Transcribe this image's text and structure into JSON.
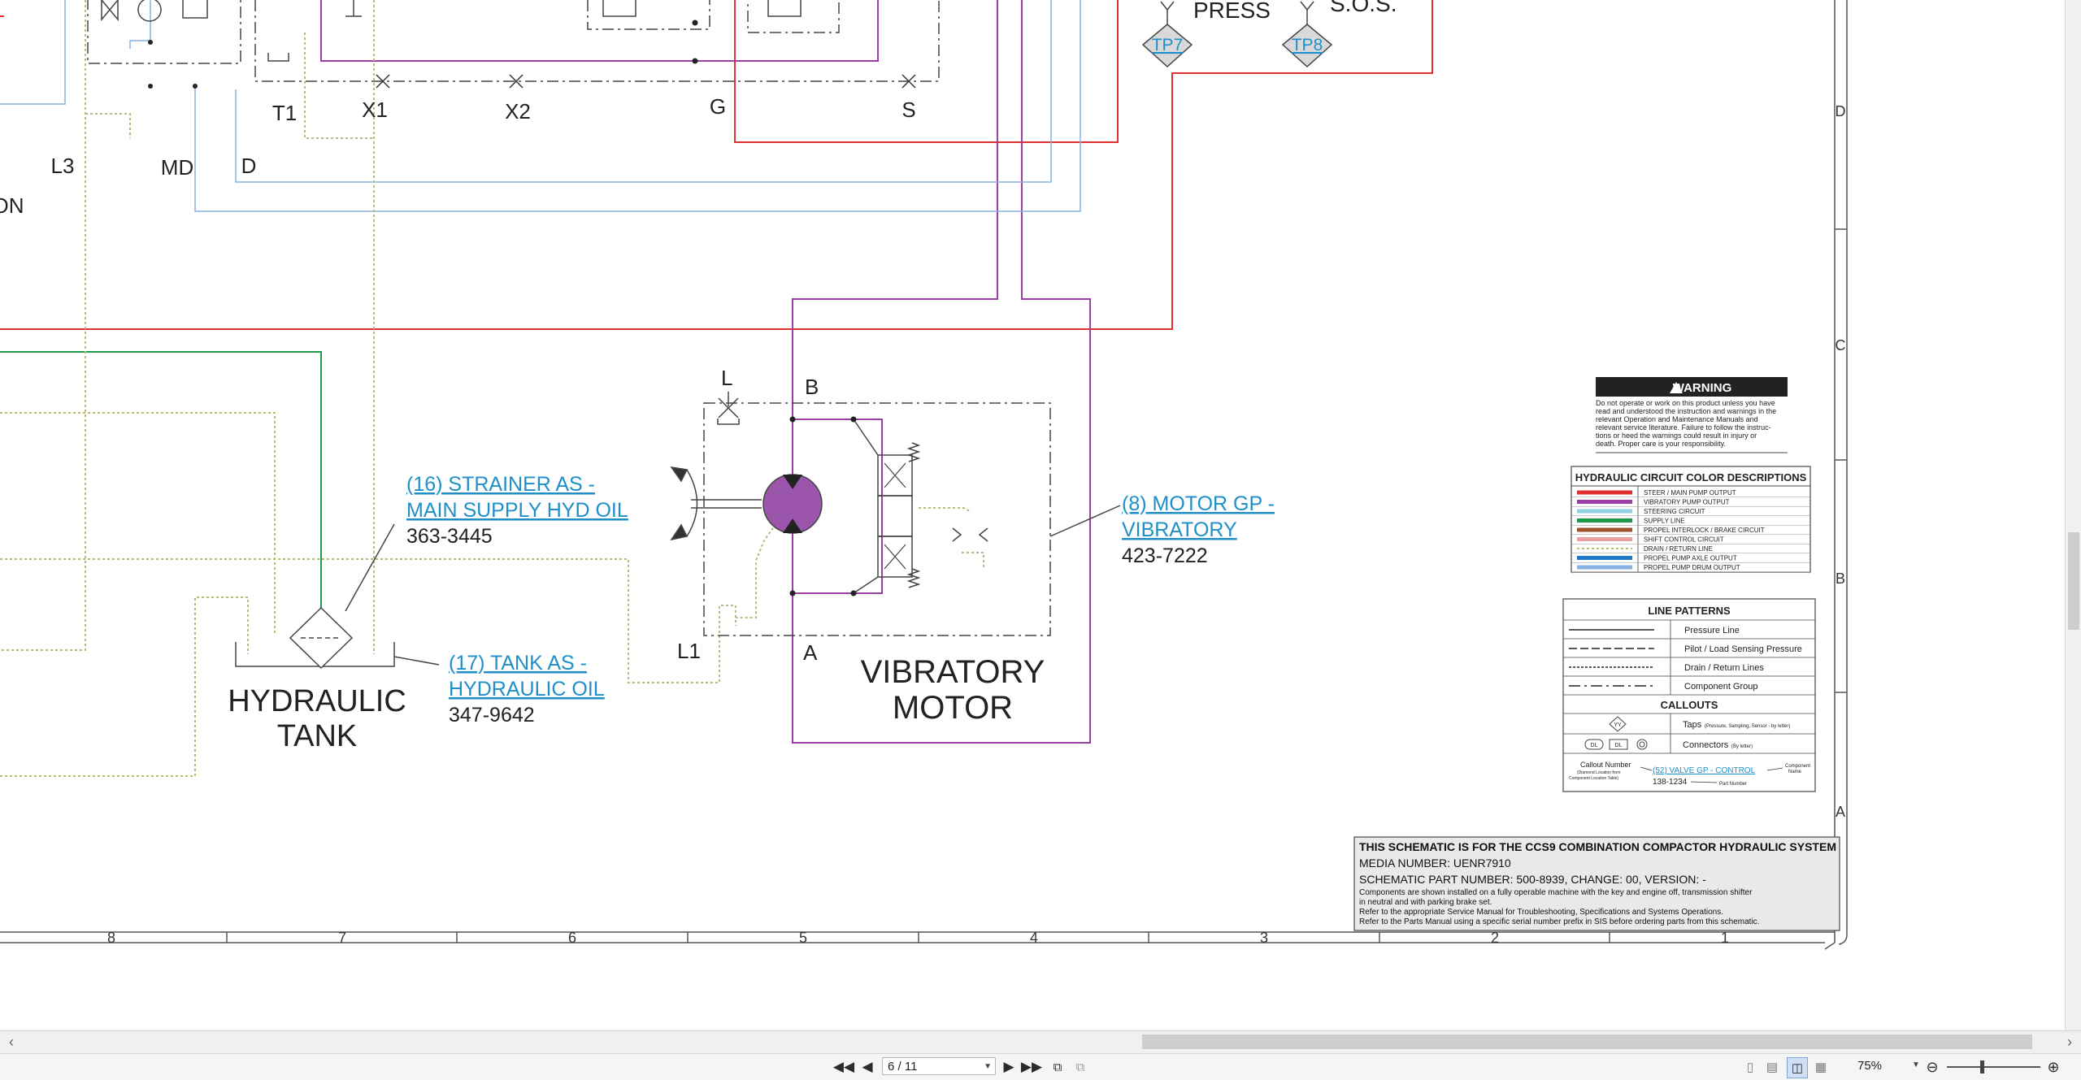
{
  "labels": {
    "press": "PRESS",
    "sos": "S.O.S.",
    "tp7": "TP7",
    "tp8": "TP8",
    "t1": "T1",
    "x1": "X1",
    "x2": "X2",
    "g": "G",
    "s": "S",
    "l3": "L3",
    "md": "MD",
    "d": "D",
    "on": "ON",
    "l": "L",
    "b": "B",
    "a": "A",
    "l1": "L1"
  },
  "components": {
    "strainer_line1": "(16) STRAINER AS -",
    "strainer_line2": "MAIN SUPPLY HYD OIL",
    "strainer_part": "363-3445",
    "tank_line1": "(17) TANK AS -",
    "tank_line2": "HYDRAULIC OIL",
    "tank_part": "347-9642",
    "tank_title1": "HYDRAULIC",
    "tank_title2": "TANK",
    "motor_line1": "(8) MOTOR GP -",
    "motor_line2": "VIBRATORY",
    "motor_part": "423-7222",
    "motor_title1": "VIBRATORY",
    "motor_title2": "MOTOR"
  },
  "zones": {
    "row_letters": [
      "D",
      "C",
      "B",
      "A"
    ],
    "col_numbers": [
      "8",
      "7",
      "6",
      "5",
      "4",
      "3",
      "2",
      "1"
    ]
  },
  "warning": {
    "title": "WARNING",
    "lines": [
      "Do not operate or work on this product unless you have",
      "read and understood the instruction and warnings in the",
      "relevant Operation and Maintenance Manuals and",
      "relevant service literature. Failure to follow the instruc-",
      "tions or heed the warnings could result in injury or",
      "death. Proper care is your responsibility."
    ]
  },
  "color_legend": {
    "title": "HYDRAULIC CIRCUIT COLOR DESCRIPTIONS",
    "items": [
      {
        "label": "STEER / MAIN PUMP OUTPUT",
        "color": "#e03030",
        "dotted": false
      },
      {
        "label": "VIBRATORY PUMP OUTPUT",
        "color": "#9b3fa6",
        "dotted": false
      },
      {
        "label": "STEERING CIRCUIT",
        "color": "#8fd0e0",
        "dotted": false
      },
      {
        "label": "SUPPLY LINE",
        "color": "#1a9a4a",
        "dotted": false
      },
      {
        "label": "PROPEL INTERLOCK / BRAKE CIRCUIT",
        "color": "#a0522d",
        "dotted": false
      },
      {
        "label": "SHIFT CONTROL CIRCUIT",
        "color": "#e8a0a0",
        "dotted": false
      },
      {
        "label": "DRAIN / RETURN LINE",
        "color": "#b8b880",
        "dotted": true
      },
      {
        "label": "PROPEL PUMP AXLE OUTPUT",
        "color": "#1f78c8",
        "dotted": false
      },
      {
        "label": "PROPEL PUMP DRUM OUTPUT",
        "color": "#88b0e0",
        "dotted": false
      }
    ]
  },
  "line_patterns": {
    "title": "LINE PATTERNS",
    "items": [
      "Pressure Line",
      "Pilot / Load Sensing Pressure",
      "Drain / Return Lines",
      "Component Group"
    ],
    "callouts_title": "CALLOUTS",
    "taps_label": "Taps",
    "taps_note": "(Pressure, Sampling, Sensor - by letter)",
    "connectors_label": "Connectors",
    "connectors_note": "(By letter)",
    "callout_number": "Callout Number",
    "callout_number_note1": "(Diamond Location from",
    "callout_number_note2": "Component Location Table)",
    "callout_sample_link": "(52) VALVE GP - CONTROL",
    "callout_sample_part": "138-1234",
    "component_name": "Component",
    "component_name2": "Name",
    "part_number": "Part Number",
    "tap_symbol": "YY",
    "conn1": "DL",
    "conn2": "DL"
  },
  "title_block": {
    "line1": "THIS SCHEMATIC IS FOR THE CCS9 COMBINATION COMPACTOR HYDRAULIC SYSTEM",
    "line2": "MEDIA NUMBER: UENR7910",
    "line3": "SCHEMATIC PART NUMBER: 500-8939, CHANGE: 00, VERSION: -",
    "line4": "Components are shown installed on a fully operable machine with the key and engine off, transmission shifter",
    "line5": "in neutral and with parking brake set.",
    "line6": "Refer to the appropriate Service Manual for Troubleshooting, Specifications and Systems Operations.",
    "line7": "Refer to the Parts Manual using a specific serial number prefix in SIS before ordering parts from this schematic."
  },
  "toolbar": {
    "page_value": "6 / 11",
    "zoom_value": "75%"
  }
}
